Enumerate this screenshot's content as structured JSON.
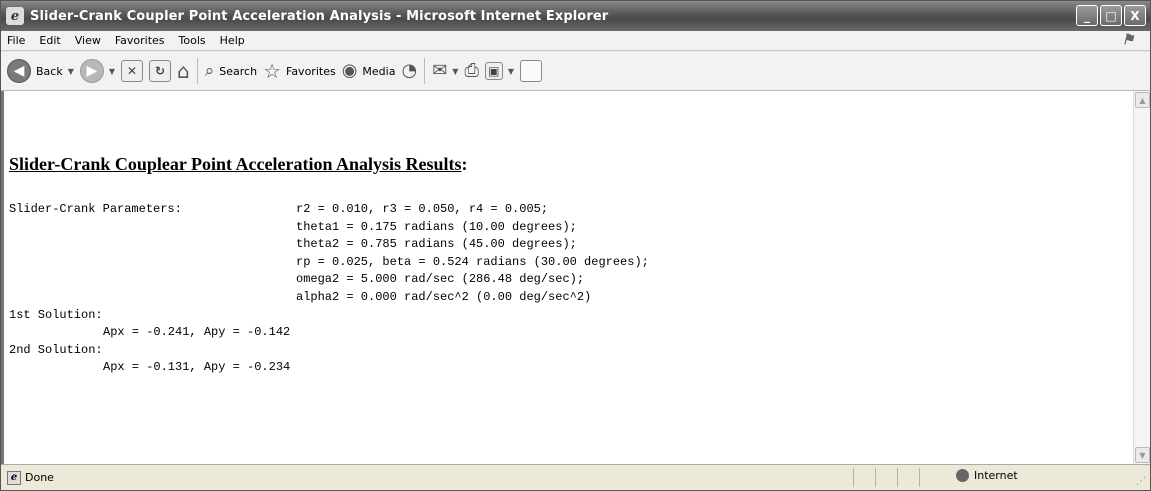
{
  "window": {
    "title": "Slider-Crank Coupler Point Acceleration Analysis - Microsoft Internet Explorer",
    "minimize": "_",
    "maximize": "□",
    "close": "X"
  },
  "menu": [
    "File",
    "Edit",
    "View",
    "Favorites",
    "Tools",
    "Help"
  ],
  "toolbar": {
    "back": "Back",
    "search": "Search",
    "favorites": "Favorites",
    "media": "Media"
  },
  "page": {
    "heading": "Slider-Crank Couplear Point Acceleration Analysis Results",
    "heading_suffix": ":",
    "params_label": "Slider-Crank Parameters:",
    "params": [
      "r2 = 0.010, r3 = 0.050, r4 = 0.005;",
      "theta1 = 0.175 radians (10.00 degrees);",
      "theta2 = 0.785 radians (45.00 degrees);",
      "rp = 0.025, beta = 0.524 radians (30.00 degrees);",
      "omega2 = 5.000 rad/sec (286.48 deg/sec);",
      "alpha2 = 0.000 rad/sec^2 (0.00 deg/sec^2)"
    ],
    "solutions": [
      {
        "label": "1st Solution:",
        "value": "Apx = -0.241, Apy = -0.142"
      },
      {
        "label": "2nd Solution:",
        "value": "Apx = -0.131, Apy = -0.234"
      }
    ]
  },
  "status": {
    "text": "Done",
    "zone": "Internet"
  },
  "icons": {
    "back": "back-arrow-icon",
    "forward": "forward-arrow-icon",
    "stop": "stop-icon",
    "refresh": "refresh-icon",
    "home": "home-icon",
    "search": "magnifier-icon",
    "favorites": "star-icon",
    "media": "media-icon",
    "history": "history-icon",
    "mail": "mail-icon",
    "print": "print-icon",
    "edit": "edit-icon",
    "discuss": "discuss-icon"
  }
}
